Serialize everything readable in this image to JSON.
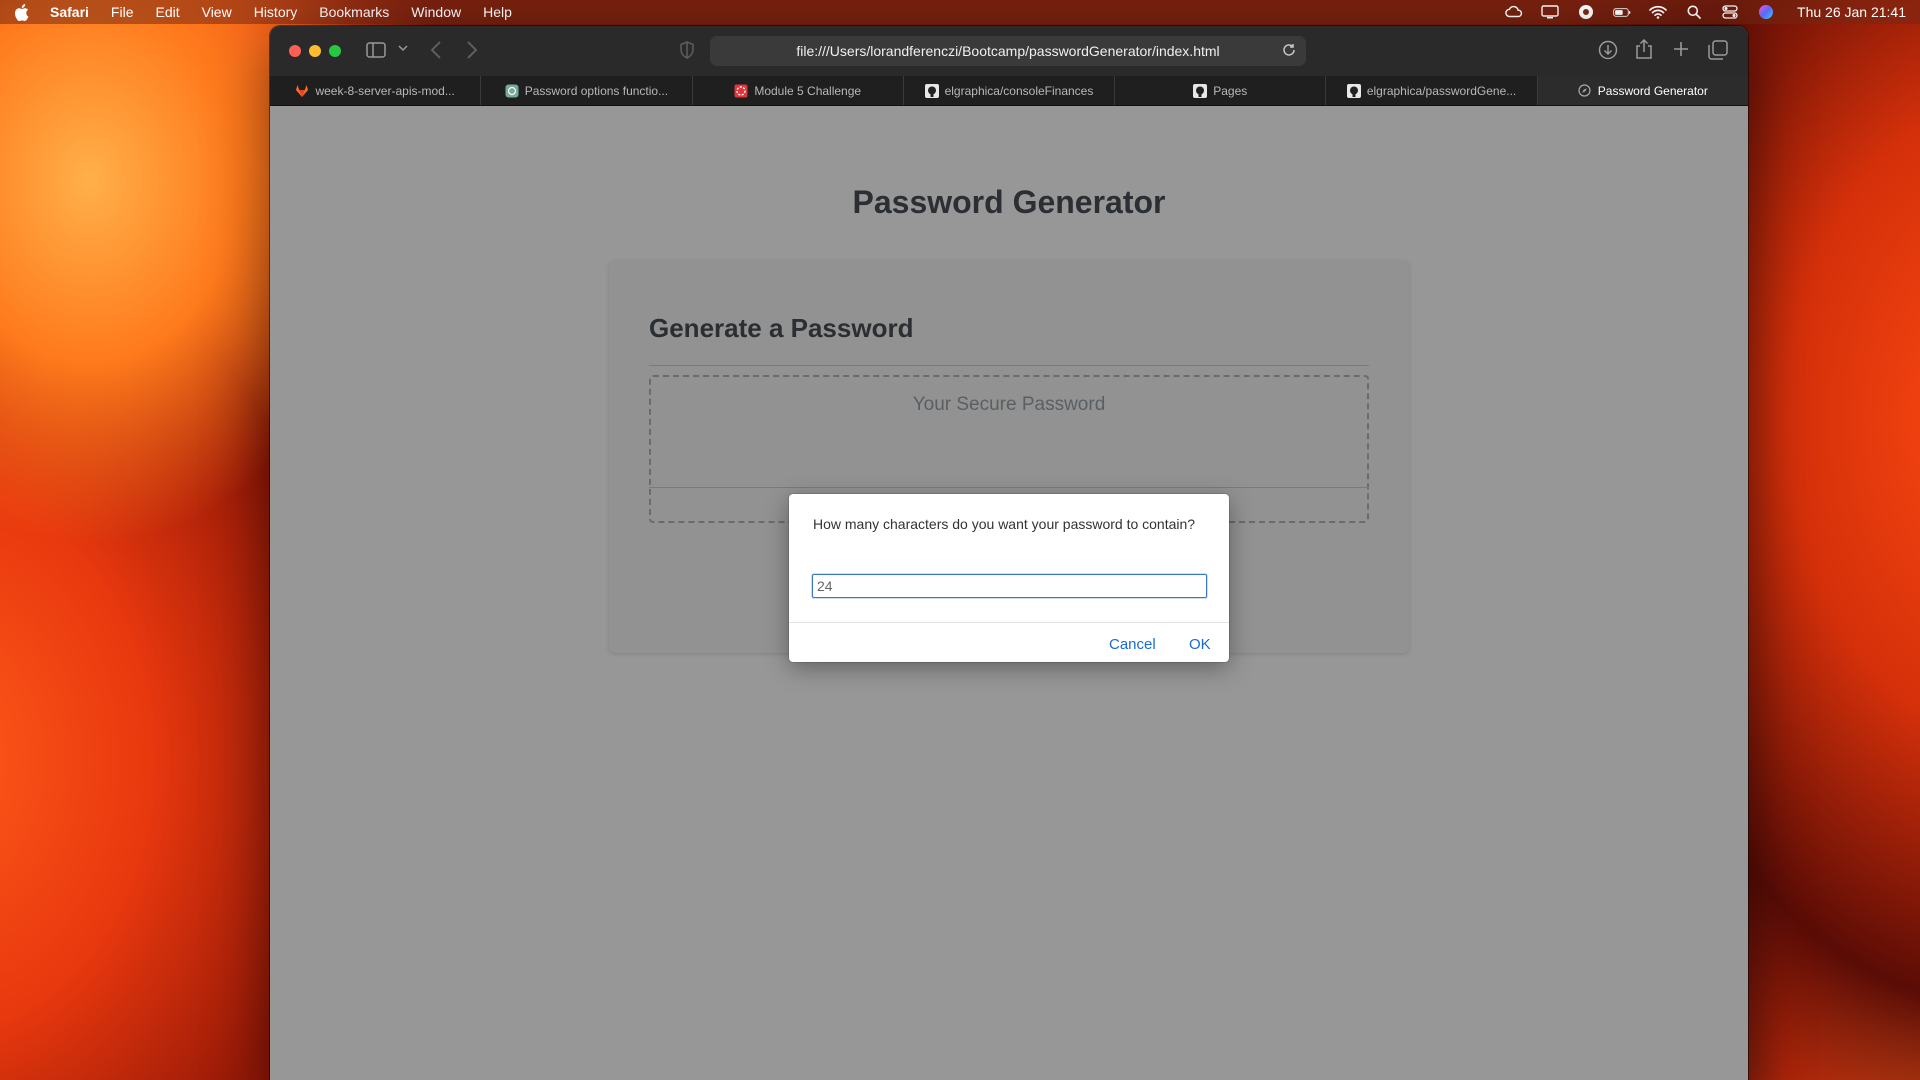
{
  "menubar": {
    "app_name": "Safari",
    "items": [
      "File",
      "Edit",
      "View",
      "History",
      "Bookmarks",
      "Window",
      "Help"
    ],
    "clock": "Thu 26 Jan  21:41"
  },
  "browser": {
    "address": "file:///Users/lorandferenczi/Bootcamp/passwordGenerator/index.html",
    "tabs": [
      {
        "label": "week-8-server-apis-mod...",
        "icon": "gitlab-icon"
      },
      {
        "label": "Password options functio...",
        "icon": "chatgpt-icon"
      },
      {
        "label": "Module 5 Challenge",
        "icon": "module-icon"
      },
      {
        "label": "elgraphica/consoleFinances",
        "icon": "github-icon"
      },
      {
        "label": "Pages",
        "icon": "github-icon"
      },
      {
        "label": "elgraphica/passwordGene...",
        "icon": "github-icon"
      },
      {
        "label": "Password Generator",
        "icon": "compass-icon",
        "active": true
      }
    ]
  },
  "page": {
    "title": "Password Generator",
    "card_header": "Generate a Password",
    "password_placeholder": "Your Secure Password"
  },
  "dialog": {
    "message": "How many characters do you want your password to contain?",
    "input_value": "24",
    "cancel_label": "Cancel",
    "ok_label": "OK"
  },
  "colors": {
    "accent": "#1a6ad4",
    "page_bg": "#979797",
    "close": "#ff5f57",
    "minimize": "#febc2e",
    "zoom": "#28c840"
  }
}
